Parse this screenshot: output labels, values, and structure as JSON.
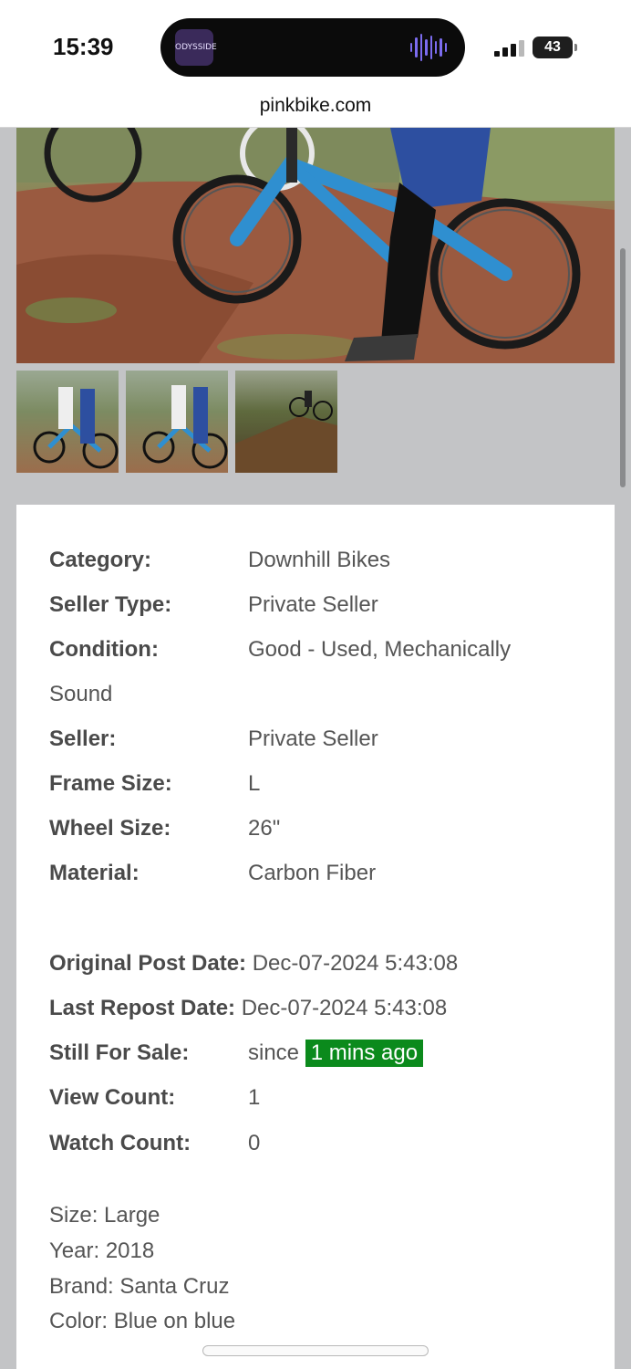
{
  "status": {
    "time": "15:39",
    "battery": "43",
    "island_app": "ODYSSIDE"
  },
  "browser": {
    "url": "pinkbike.com"
  },
  "details": {
    "category_label": "Category:",
    "category_value": "Downhill Bikes",
    "seller_type_label": "Seller Type:",
    "seller_type_value": "Private Seller",
    "condition_label": "Condition:",
    "condition_value_line1": "Good - Used, Mechanically",
    "condition_value_line2": "Sound",
    "seller_label": "Seller:",
    "seller_value": "Private Seller",
    "frame_size_label": "Frame Size:",
    "frame_size_value": "L",
    "wheel_size_label": "Wheel Size:",
    "wheel_size_value": "26\"",
    "material_label": "Material:",
    "material_value": "Carbon Fiber",
    "original_post_label": "Original Post Date:",
    "original_post_value": "Dec-07-2024 5:43:08",
    "last_repost_label": "Last Repost Date:",
    "last_repost_value": "Dec-07-2024 5:43:08",
    "still_for_sale_label": "Still For Sale:",
    "still_for_sale_prefix": "since",
    "still_for_sale_badge": "1 mins ago",
    "view_count_label": "View Count:",
    "view_count_value": "1",
    "watch_count_label": "Watch Count:",
    "watch_count_value": "0"
  },
  "description": {
    "line1": "Size: Large",
    "line2": "Year: 2018",
    "line3": "Brand: Santa Cruz",
    "line4": "Color: Blue on blue"
  },
  "colors": {
    "badge_green": "#0b8a1c",
    "bike_blue": "#2f8fd0"
  }
}
